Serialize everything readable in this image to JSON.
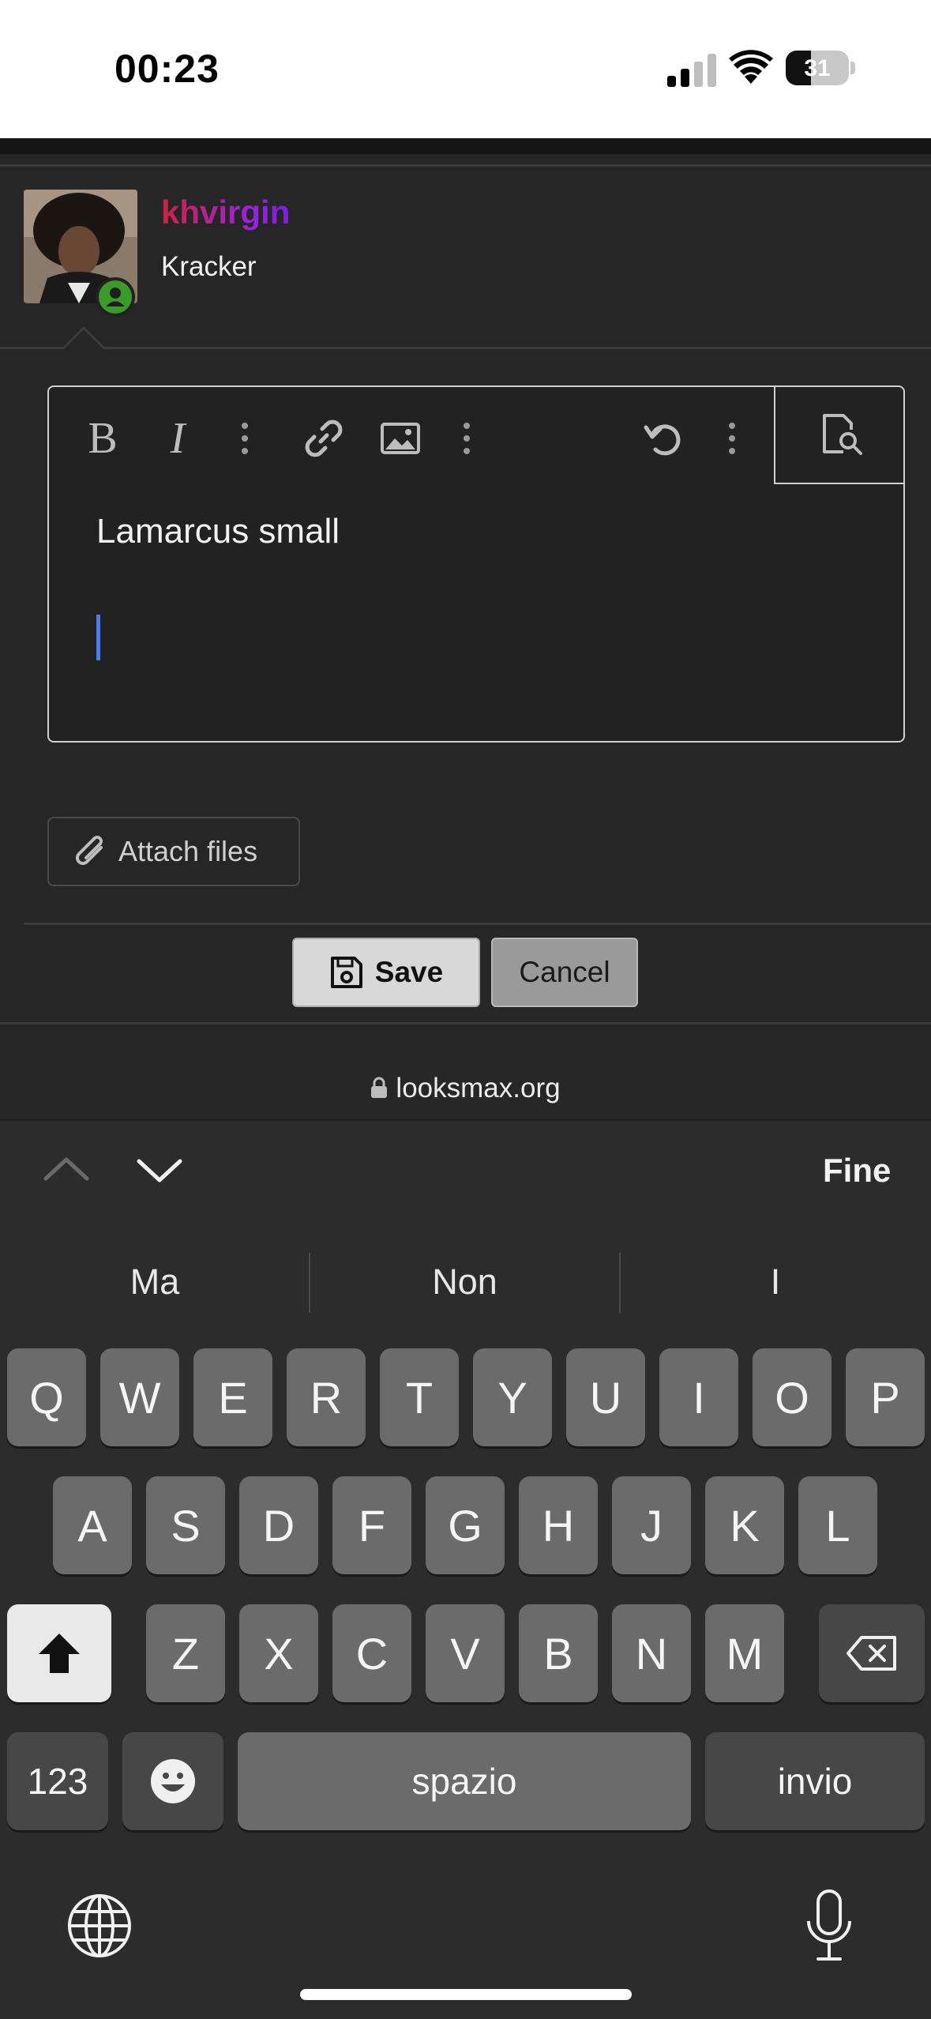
{
  "status_bar": {
    "time": "00:23",
    "battery_level": "31"
  },
  "post": {
    "username": "khvirgin",
    "user_title": "Kracker",
    "editor_text": "Lamarcus small"
  },
  "toolbar": {
    "bold": "B",
    "italic": "I"
  },
  "actions": {
    "attach_label": "Attach files",
    "save_label": "Save",
    "cancel_label": "Cancel"
  },
  "browser": {
    "url": "looksmax.org"
  },
  "keyboard": {
    "done_label": "Fine",
    "suggestions": [
      "Ma",
      "Non",
      "I"
    ],
    "row1": [
      "Q",
      "W",
      "E",
      "R",
      "T",
      "Y",
      "U",
      "I",
      "O",
      "P"
    ],
    "row2": [
      "A",
      "S",
      "D",
      "F",
      "G",
      "H",
      "J",
      "K",
      "L"
    ],
    "row3": [
      "Z",
      "X",
      "C",
      "V",
      "B",
      "N",
      "M"
    ],
    "numbers_label": "123",
    "space_label": "spazio",
    "return_label": "invio"
  }
}
